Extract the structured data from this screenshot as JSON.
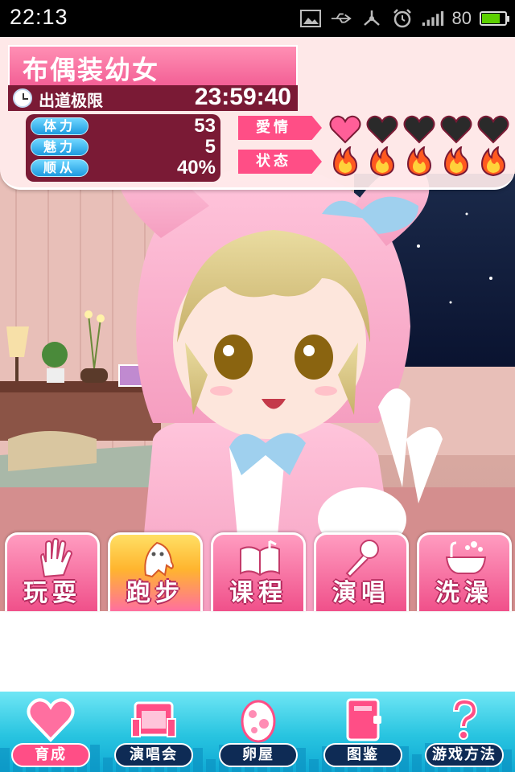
{
  "status_bar": {
    "time": "22:13",
    "battery": "80",
    "battery_level": 0.8
  },
  "game": {
    "title": "布偶装幼女",
    "deadline_label": "出道极限",
    "deadline_time": "23:59:40",
    "stats": [
      {
        "label": "体力",
        "value": "53"
      },
      {
        "label": "魅力",
        "value": "5"
      },
      {
        "label": "顺从",
        "value": "40%"
      }
    ],
    "affection": {
      "label": "愛情",
      "filled": 1,
      "total": 5,
      "colors": {
        "filled": "#ff5f98",
        "empty": "#2a2a2a"
      }
    },
    "status": {
      "label": "状态",
      "count": 5,
      "icon": "fire-icon"
    }
  },
  "actions": [
    {
      "label": "玩耍",
      "icon": "hand-icon"
    },
    {
      "label": "跑步",
      "icon": "ghost-icon",
      "active": true
    },
    {
      "label": "课程",
      "icon": "book-icon"
    },
    {
      "label": "演唱",
      "icon": "microphone-icon"
    },
    {
      "label": "洗澡",
      "icon": "bathtub-icon"
    }
  ],
  "nav": [
    {
      "label": "育成",
      "icon": "heart-icon",
      "active": true
    },
    {
      "label": "演唱会",
      "icon": "stage-icon"
    },
    {
      "label": "卵屋",
      "icon": "egg-icon"
    },
    {
      "label": "图鉴",
      "icon": "book-icon"
    },
    {
      "label": "游戏方法",
      "icon": "question-icon"
    }
  ],
  "colors": {
    "accent": "#ff4e86",
    "panel_dark": "#7a1a35",
    "nav": "#28c4e0"
  }
}
